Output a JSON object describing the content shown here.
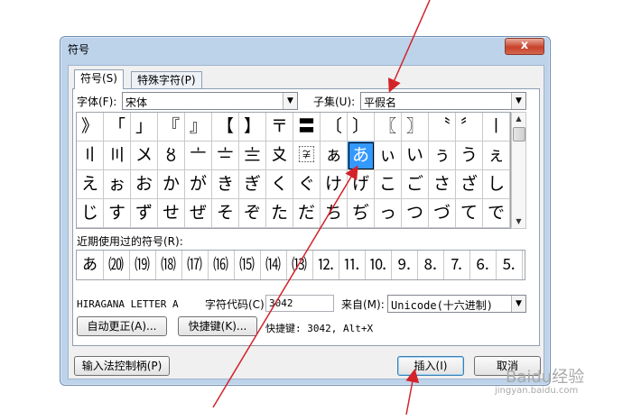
{
  "dialog": {
    "title": "符号",
    "close_glyph": "x",
    "tabs": [
      "符号(S)",
      "特殊字符(P)"
    ],
    "font_label": "字体(F):",
    "font_value": "宋体",
    "subset_label": "子集(U):",
    "subset_value": "平假名",
    "symbols": [
      "》",
      "「",
      "」",
      "『",
      "』",
      "【",
      "】",
      "〒",
      "〓",
      "〔",
      "〕",
      "〖",
      "〗",
      "〝",
      "〞",
      "〡",
      "〢",
      "〣",
      "〤",
      "〥",
      "〦",
      "〧",
      "〨",
      "〩",
      "〾",
      "ぁ",
      "あ",
      "ぃ",
      "い",
      "ぅ",
      "う",
      "ぇ",
      "え",
      "ぉ",
      "お",
      "か",
      "が",
      "き",
      "ぎ",
      "く",
      "ぐ",
      "け",
      "げ",
      "こ",
      "ご",
      "さ",
      "ざ",
      "し",
      "じ",
      "す",
      "ず",
      "せ",
      "ぜ",
      "そ",
      "ぞ",
      "た",
      "だ",
      "ち",
      "ぢ",
      "っ",
      "つ",
      "づ",
      "て",
      "で"
    ],
    "selected_index": 26,
    "recent_label": "近期使用过的符号(R):",
    "recent": [
      "あ",
      "⒇",
      "⒆",
      "⒅",
      "⒄",
      "⒃",
      "⒂",
      "⒁",
      "⒀",
      "⒓",
      "⒒",
      "⒑",
      "⒐",
      "⒏",
      "⒎",
      "⒍",
      "⒌"
    ],
    "char_name": "HIRAGANA LETTER A",
    "char_code_label": "字符代码(C):",
    "char_code_value": "3042",
    "from_label": "来自(M):",
    "from_value": "Unicode(十六进制)",
    "autocorrect_button": "自动更正(A)...",
    "shortcut_button": "快捷键(K)...",
    "shortcut_text": "快捷键: 3042, Alt+X",
    "ime_button": "输入法控制柄(P)",
    "insert_button": "插入(I)",
    "cancel_button": "取消"
  },
  "watermark": {
    "text": "Baidu经验",
    "url": "jingyan.baidu.com"
  },
  "colors": {
    "selection": "#3399ff",
    "annotation_arrow": "#d3222a"
  }
}
